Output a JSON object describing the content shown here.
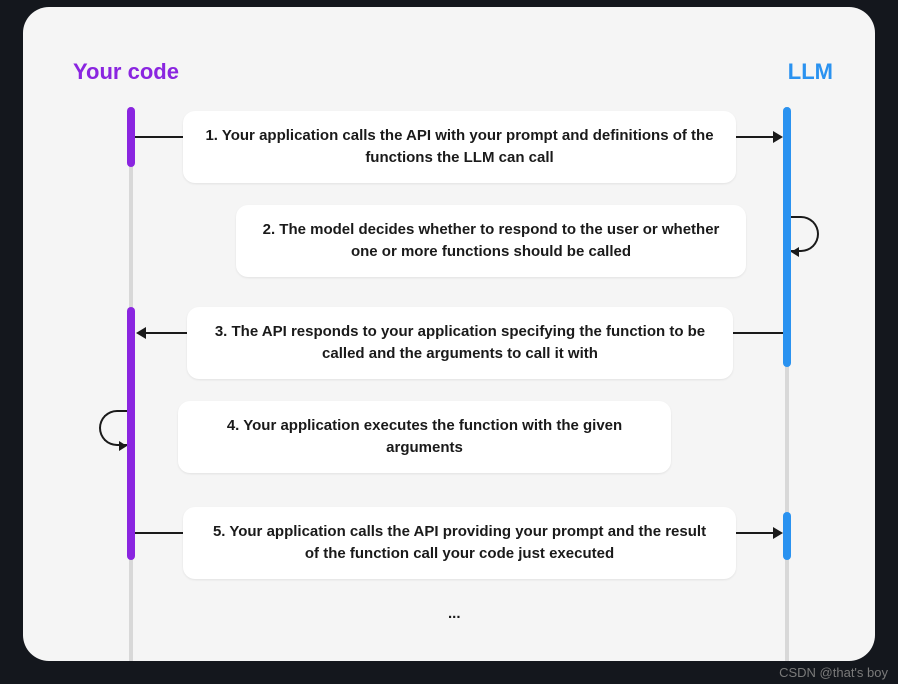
{
  "participants": {
    "left": "Your code",
    "right": "LLM"
  },
  "steps": {
    "s1": "1. Your application calls the API with your prompt and definitions of the functions the LLM can call",
    "s2": "2. The model decides whether to respond to the user or whether one or more functions should be called",
    "s3": "3. The API responds to your application specifying the function to be called and the arguments to call it with",
    "s4": "4. Your application executes the function with the given  arguments",
    "s5": "5. Your application calls the API providing your prompt and the result of the function call your code just executed"
  },
  "ellipsis": "...",
  "watermark": "CSDN @that's boy"
}
